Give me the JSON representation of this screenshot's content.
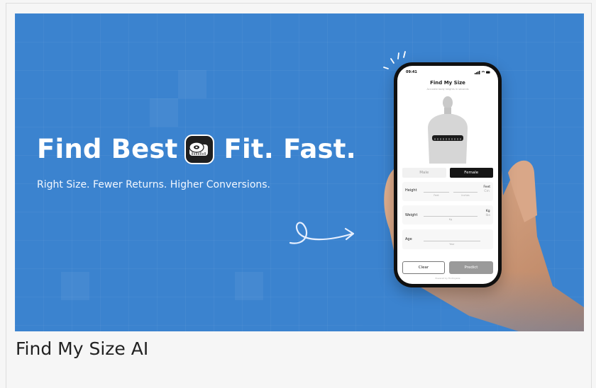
{
  "banner": {
    "headline_left": "Find Best",
    "headline_right": "Fit. Fast.",
    "tagline": "Right Size. Fewer Returns. Higher Conversions.",
    "background_color": "#3b83cf",
    "logo_icon": "measuring-tape-icon"
  },
  "phone": {
    "time": "09:41",
    "title": "Find My Size",
    "subtitle": "Accurate body heights in seconds",
    "gender_options": [
      "Male",
      "Female"
    ],
    "selected_gender": "Female",
    "height": {
      "label": "Height",
      "hint_feet": "Feet",
      "hint_inches": "Inches",
      "unit_active": "Feet",
      "unit_inactive": "Cm"
    },
    "weight": {
      "label": "Weight",
      "hint": "Kg",
      "unit_active": "Kg",
      "unit_inactive": "lbs"
    },
    "age": {
      "label": "Age",
      "hint": "Year"
    },
    "clear_label": "Clear",
    "predict_label": "Predict",
    "powered_by": "Powered by Findmysize"
  },
  "caption": "Find My Size AI"
}
